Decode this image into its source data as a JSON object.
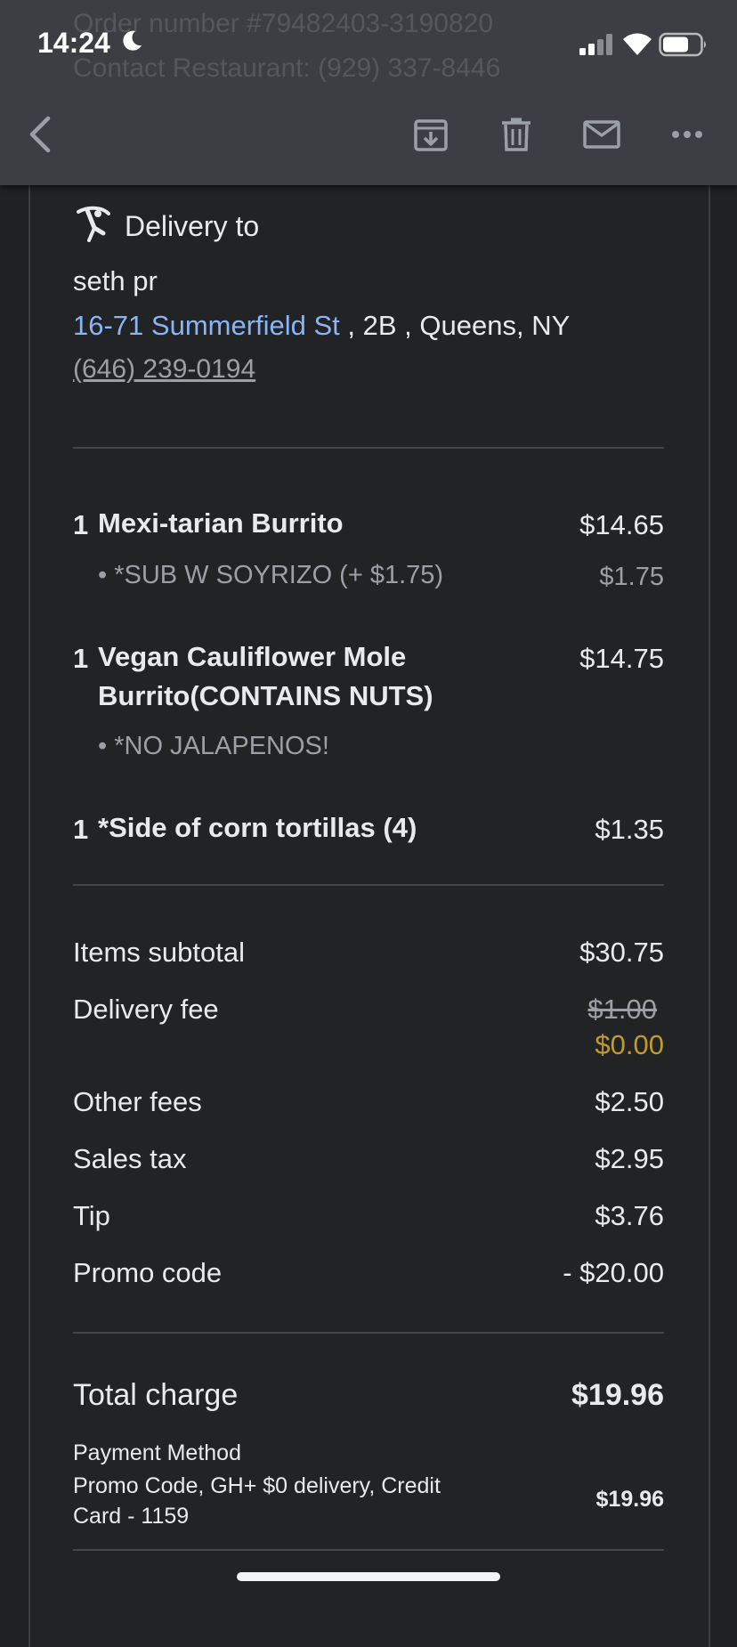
{
  "status_bar": {
    "time": "14:24"
  },
  "background_header": {
    "order_number": "Order number #79482403-3190820",
    "contact_restaurant": "Contact Restaurant: (929) 337-8446"
  },
  "toolbar": {
    "back": "back-icon",
    "archive": "archive-icon",
    "delete": "trash-icon",
    "mark_unread": "mail-icon",
    "more": "more-icon"
  },
  "delivery": {
    "title": "Delivery to",
    "name": "seth pr",
    "street": "16-71 Summerfield St",
    "address_rest": " , 2B , Queens, NY",
    "phone": "(646) 239-0194"
  },
  "items": [
    {
      "qty": "1",
      "name": "Mexi-tarian Burrito",
      "price": "$14.65",
      "modifier": "• *SUB W SOYRIZO (+ $1.75)",
      "modifier_price": "$1.75"
    },
    {
      "qty": "1",
      "name_line1": "Vegan Cauliflower Mole",
      "name_line2": "Burrito(CONTAINS NUTS)",
      "price": "$14.75",
      "modifier": "• *NO JALAPENOS!"
    },
    {
      "qty": "1",
      "name": "*Side of corn tortillas (4)",
      "price": "$1.35"
    }
  ],
  "summary": {
    "subtotal_label": "Items subtotal",
    "subtotal": "$30.75",
    "delivery_label": "Delivery fee",
    "delivery_original": "$1.00",
    "delivery": "$0.00",
    "other_label": "Other fees",
    "other": "$2.50",
    "tax_label": "Sales tax",
    "tax": "$2.95",
    "tip_label": "Tip",
    "tip": "$3.76",
    "promo_label": "Promo code",
    "promo": "- $20.00"
  },
  "total": {
    "label": "Total charge",
    "value": "$19.96",
    "payment_label": "Payment Method",
    "payment_desc": "Promo Code, GH+ $0 delivery, Credit Card - 1159",
    "payment_value": "$19.96"
  },
  "colors": {
    "link": "#8ab4f8",
    "discount": "#c19a2e",
    "background": "#202124"
  }
}
